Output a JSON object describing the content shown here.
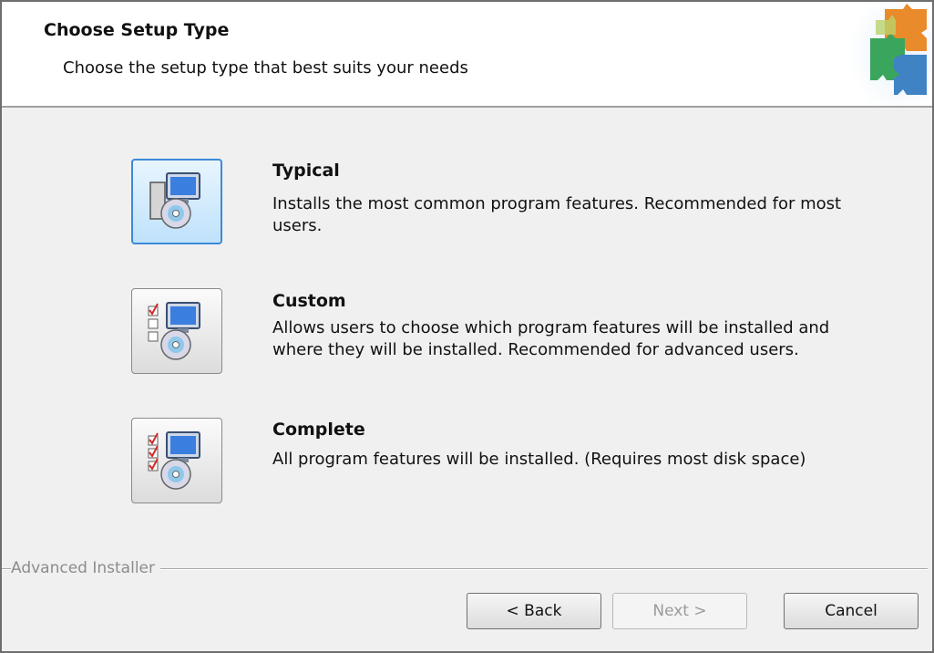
{
  "header": {
    "title": "Choose Setup Type",
    "subtitle": "Choose the setup type that best suits your needs"
  },
  "options": [
    {
      "title": "Typical",
      "description": "Installs the most common program features. Recommended for most users.",
      "selected": true,
      "icon": "typical-setup-icon"
    },
    {
      "title": "Custom",
      "description": "Allows users to choose which program features will be installed and where they will be installed. Recommended for advanced users.",
      "selected": false,
      "icon": "custom-setup-icon"
    },
    {
      "title": "Complete",
      "description": "All program features will be installed.  (Requires most disk space)",
      "selected": false,
      "icon": "complete-setup-icon"
    }
  ],
  "footer": {
    "brand": "Advanced Installer",
    "back_label": "< Back",
    "next_label": "Next >",
    "cancel_label": "Cancel",
    "next_enabled": false
  },
  "colors": {
    "selected_border": "#3c8ad8",
    "selected_fill": "#bfe2fb",
    "header_bg": "#ffffff",
    "body_bg": "#f0f0f0"
  }
}
